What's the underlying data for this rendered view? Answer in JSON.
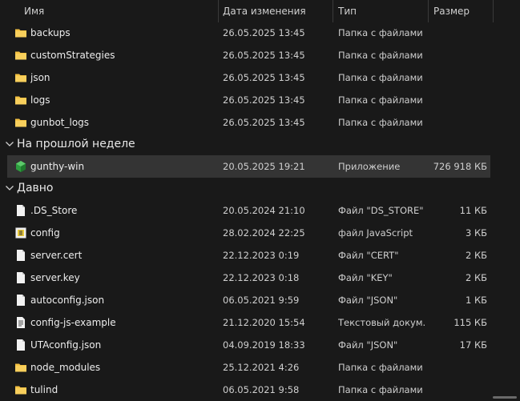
{
  "columns": {
    "name": "Имя",
    "date": "Дата изменения",
    "type": "Тип",
    "size": "Размер"
  },
  "folders_top": [
    {
      "name": "backups",
      "date": "26.05.2025 13:45",
      "type": "Папка с файлами",
      "size": "",
      "icon": "folder-icon"
    },
    {
      "name": "customStrategies",
      "date": "26.05.2025 13:45",
      "type": "Папка с файлами",
      "size": "",
      "icon": "folder-icon"
    },
    {
      "name": "json",
      "date": "26.05.2025 13:45",
      "type": "Папка с файлами",
      "size": "",
      "icon": "folder-icon"
    },
    {
      "name": "logs",
      "date": "26.05.2025 13:45",
      "type": "Папка с файлами",
      "size": "",
      "icon": "folder-icon"
    },
    {
      "name": "gunbot_logs",
      "date": "26.05.2025 13:45",
      "type": "Папка с файлами",
      "size": "",
      "icon": "folder-icon"
    }
  ],
  "group_last_week": {
    "label": "На прошлой неделе",
    "rows": [
      {
        "name": "gunthy-win",
        "date": "20.05.2025 19:21",
        "type": "Приложение",
        "size": "726 918 КБ",
        "icon": "app-cube-icon"
      }
    ]
  },
  "group_long_ago": {
    "label": "Давно",
    "rows": [
      {
        "name": ".DS_Store",
        "date": "20.05.2024 21:10",
        "type": "Файл \"DS_STORE\"",
        "size": "11 КБ",
        "icon": "file-icon"
      },
      {
        "name": "config",
        "date": "28.02.2024 22:25",
        "type": "файл JavaScript",
        "size": "3 КБ",
        "icon": "javascript-file-icon"
      },
      {
        "name": "server.cert",
        "date": "22.12.2023 0:19",
        "type": "Файл \"CERT\"",
        "size": "2 КБ",
        "icon": "file-icon"
      },
      {
        "name": "server.key",
        "date": "22.12.2023 0:18",
        "type": "Файл \"KEY\"",
        "size": "2 КБ",
        "icon": "file-icon"
      },
      {
        "name": "autoconfig.json",
        "date": "06.05.2021 9:59",
        "type": "Файл \"JSON\"",
        "size": "1 КБ",
        "icon": "file-icon"
      },
      {
        "name": "config-js-example",
        "date": "21.12.2020 15:54",
        "type": "Текстовый докум...",
        "size": "115 КБ",
        "icon": "text-document-icon"
      },
      {
        "name": "UTAconfig.json",
        "date": "04.09.2019 18:33",
        "type": "Файл \"JSON\"",
        "size": "17 КБ",
        "icon": "file-icon"
      },
      {
        "name": "node_modules",
        "date": "25.12.2021 4:26",
        "type": "Папка с файлами",
        "size": "",
        "icon": "folder-icon"
      },
      {
        "name": "tulind",
        "date": "06.05.2021 9:58",
        "type": "Папка с файлами",
        "size": "",
        "icon": "folder-icon"
      }
    ]
  },
  "colors": {
    "background": "#191919",
    "selected_row": "#343434",
    "folder": "#f5c242",
    "app_cube": "#2e9e3f"
  }
}
